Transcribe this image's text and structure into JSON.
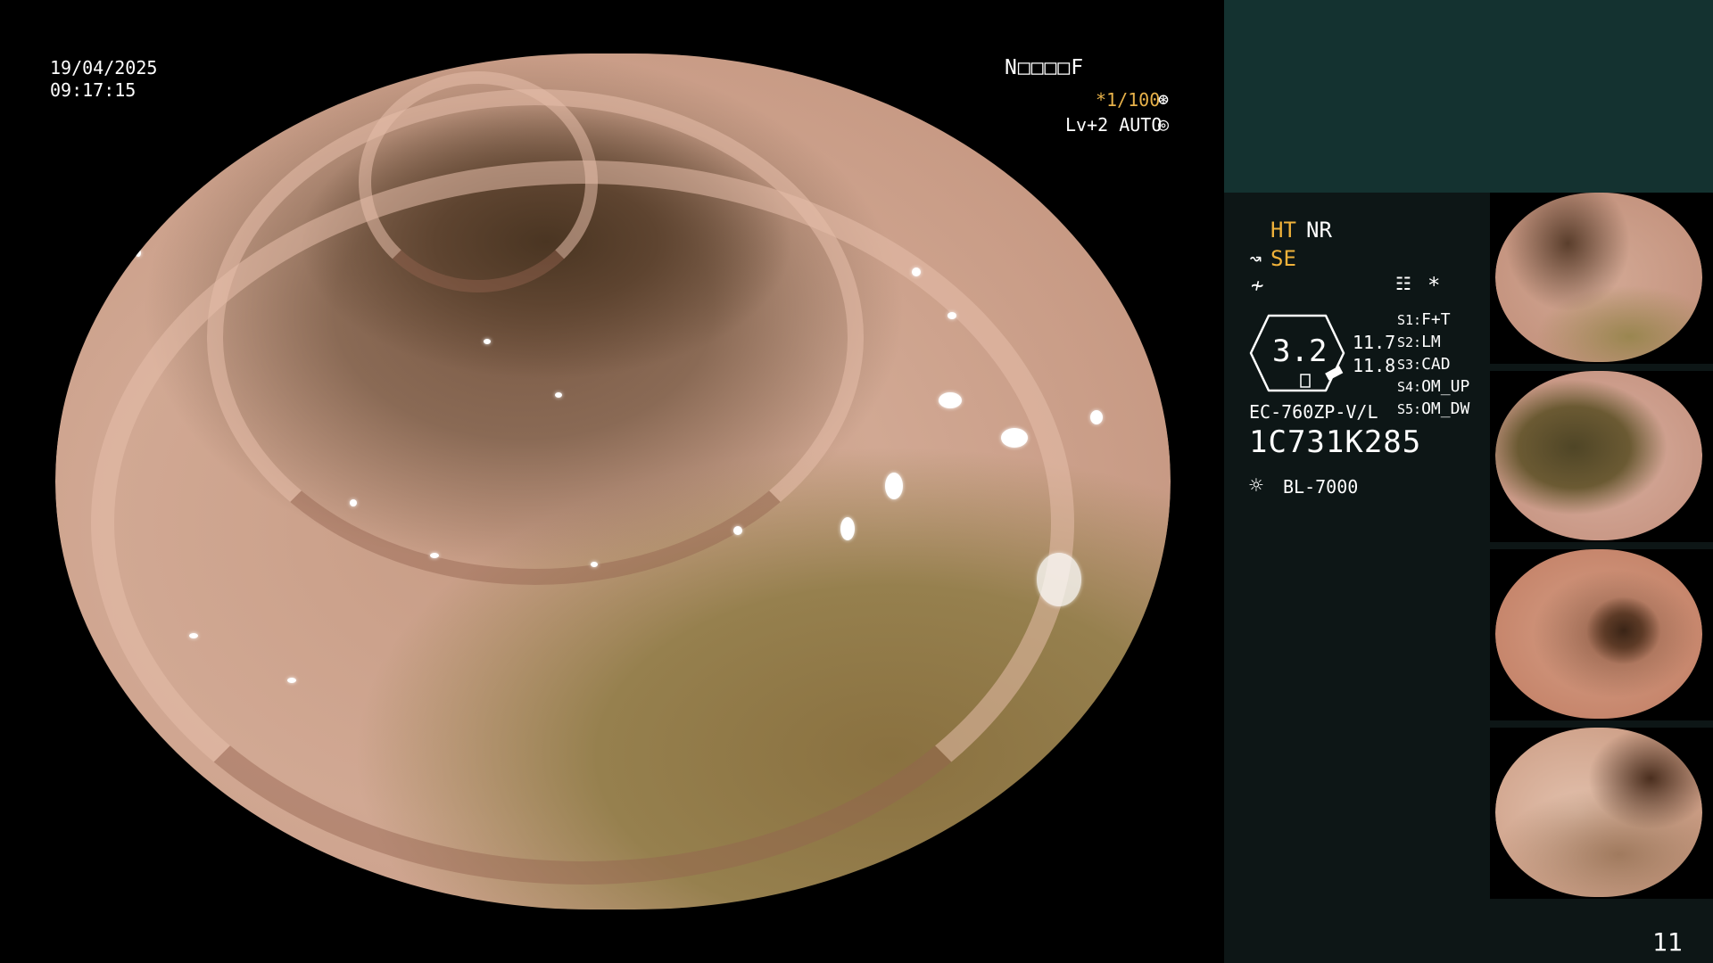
{
  "overlay": {
    "date": "19/04/2025",
    "time": "09:17:15",
    "patient_id": "N□□□□F",
    "shutter": "*1/100",
    "shutter_icon": "⊛",
    "level": "Lv+2 AUTO",
    "auto_icon": "◎"
  },
  "panel": {
    "ht": "HT",
    "nr": "NR",
    "se_icon": "↝",
    "se": "SE",
    "filter_icon": "≁",
    "menu_icon": "☷",
    "star": "*",
    "scope_value": "3.2",
    "values": [
      "11.7",
      "11.8"
    ],
    "model": "EC-760ZP-V/L",
    "serial": "1C731K285",
    "light_icon": "☼",
    "light": "BL-7000",
    "scenes": [
      {
        "key": "S1:",
        "label": "F+T"
      },
      {
        "key": "S2:",
        "label": "LM"
      },
      {
        "key": "S3:",
        "label": "CAD"
      },
      {
        "key": "S4:",
        "label": "OM_UP"
      },
      {
        "key": "S5:",
        "label": "OM_DW"
      }
    ],
    "page_number": "11"
  },
  "colors": {
    "accent": "#f0b23a",
    "panel_bg": "#0d1616",
    "panel_top_bg": "#143230"
  }
}
